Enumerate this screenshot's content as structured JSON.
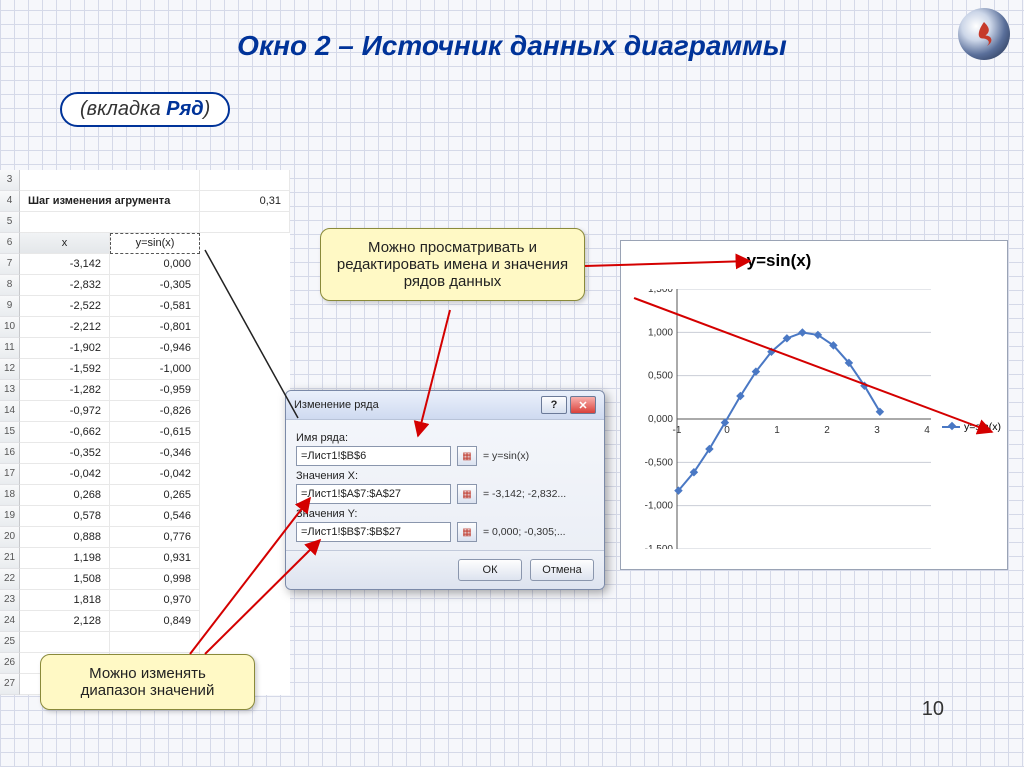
{
  "title": "Окно 2 – Источник данных диаграммы",
  "subtitle_open": "(вкладка ",
  "subtitle_word": "Ряд",
  "subtitle_close": ")",
  "page_number": "10",
  "callout_top": "Можно просматривать и редактировать имена и значения рядов данных",
  "callout_bottom": "Можно изменять диапазон значений",
  "spreadsheet": {
    "step_label": "Шаг изменения агрумента",
    "step_value": "0,31",
    "col_x": "x",
    "col_y": "y=sin(x)",
    "row_start": 3,
    "rows": [
      {
        "n": "7",
        "x": "-3,142",
        "y": "0,000"
      },
      {
        "n": "8",
        "x": "-2,832",
        "y": "-0,305"
      },
      {
        "n": "9",
        "x": "-2,522",
        "y": "-0,581"
      },
      {
        "n": "10",
        "x": "-2,212",
        "y": "-0,801"
      },
      {
        "n": "11",
        "x": "-1,902",
        "y": "-0,946"
      },
      {
        "n": "12",
        "x": "-1,592",
        "y": "-1,000"
      },
      {
        "n": "13",
        "x": "-1,282",
        "y": "-0,959"
      },
      {
        "n": "14",
        "x": "-0,972",
        "y": "-0,826"
      },
      {
        "n": "15",
        "x": "-0,662",
        "y": "-0,615"
      },
      {
        "n": "16",
        "x": "-0,352",
        "y": "-0,346"
      },
      {
        "n": "17",
        "x": "-0,042",
        "y": "-0,042"
      },
      {
        "n": "18",
        "x": "0,268",
        "y": "0,265"
      },
      {
        "n": "19",
        "x": "0,578",
        "y": "0,546"
      },
      {
        "n": "20",
        "x": "0,888",
        "y": "0,776"
      },
      {
        "n": "21",
        "x": "1,198",
        "y": "0,931"
      },
      {
        "n": "22",
        "x": "1,508",
        "y": "0,998"
      },
      {
        "n": "23",
        "x": "1,818",
        "y": "0,970"
      },
      {
        "n": "24",
        "x": "2,128",
        "y": "0,849"
      },
      {
        "n": "25",
        "x": "",
        "y": ""
      },
      {
        "n": "26",
        "x": "",
        "y": ""
      },
      {
        "n": "27",
        "x": "",
        "y": ""
      }
    ]
  },
  "dialog": {
    "title": "Изменение ряда",
    "name_label": "Имя ряда:",
    "name_value": "=Лист1!$B$6",
    "name_preview": "= y=sin(x)",
    "xvals_label": "Значения X:",
    "xvals_value": "=Лист1!$A$7:$A$27",
    "xvals_preview": "= -3,142; -2,832...",
    "yvals_label": "Значения Y:",
    "yvals_value": "=Лист1!$B$7:$B$27",
    "yvals_preview": "= 0,000; -0,305;...",
    "ok": "ОК",
    "cancel": "Отмена"
  },
  "chart_data": {
    "type": "line",
    "title": "y=sin(x)",
    "legend": "y=sin(x)",
    "x_ticks": [
      -1,
      0,
      1,
      2,
      3,
      4
    ],
    "y_ticks": [
      1.5,
      1.0,
      0.5,
      0.0,
      -0.5,
      -1.0,
      -1.5
    ],
    "y_tick_labels": [
      "1,500",
      "1,000",
      "0,500",
      "0,000",
      "-0,500",
      "-1,000",
      "-1,500"
    ],
    "ylim": [
      -1.5,
      1.5
    ],
    "xlim": [
      -1,
      4
    ],
    "series": [
      {
        "name": "y=sin(x)",
        "x": [
          -0.971,
          -0.662,
          -0.352,
          -0.042,
          0.268,
          0.578,
          0.888,
          1.198,
          1.508,
          1.818,
          2.128,
          2.438,
          2.748,
          3.058
        ],
        "y": [
          -0.826,
          -0.615,
          -0.346,
          -0.042,
          0.265,
          0.546,
          0.776,
          0.931,
          0.998,
          0.97,
          0.849,
          0.647,
          0.384,
          0.083
        ]
      }
    ]
  }
}
